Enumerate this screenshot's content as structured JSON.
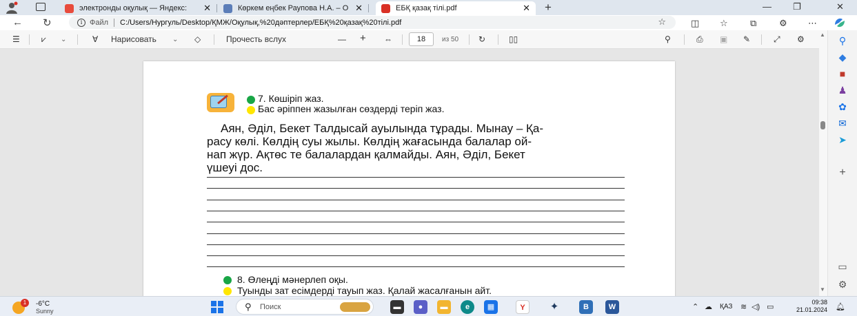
{
  "browser": {
    "tabs": [
      {
        "title": "электронды оқулық — Яндекс: ",
        "favicon_color": "#e84b3c",
        "active": false
      },
      {
        "title": "Көркем еңбек Раупова Н.А. – О",
        "favicon_color": "#5b7db8",
        "active": false
      },
      {
        "title": "ЕБҚ қазақ тілі.pdf",
        "favicon_color": "#d93025",
        "active": true
      }
    ],
    "new_tab_glyph": "+",
    "address": {
      "scheme_label": "Файл",
      "url": "C:/Users/Нургуль/Desktop/ҚМЖ/Оқулық,%20дәптерлер/ЕБҚ%20қазақ%20тілі.pdf"
    }
  },
  "pdf_toolbar": {
    "draw_label": "Нарисовать",
    "read_aloud_label": "Прочесть вслух",
    "page_number": "18",
    "page_total": "из 50"
  },
  "page": {
    "task7": {
      "line1": "7. Көшіріп жаз.",
      "line2": "Бас әріппен жазылған сөздерді теріп жаз."
    },
    "paragraph": [
      "Аян, Әділ, Бекет Талдысай ауылында тұрады. Мынау – Қа-",
      "расу көлі. Көлдің суы жылы. Көлдің жағасында балалар ой-",
      "нап жүр. Ақтөс те балалардан қалмайды. Аян, Әділ, Бекет",
      "үшеуі дос."
    ],
    "writing_lines": 9,
    "task8": {
      "line1": "8. Өлеңді мәнерлеп оқы.",
      "line2": "Туынды зат есімдерді тауып жаз. Қалай жасалғанын айт."
    },
    "colors": {
      "green_dot": "#19a646",
      "yellow_dot": "#ffe600"
    }
  },
  "taskbar": {
    "weather": {
      "temp": "-6°C",
      "condition": "Sunny",
      "badge": "1"
    },
    "search_placeholder": "Поиск",
    "apps": [
      {
        "name": "yandex-browser",
        "letter": "Y",
        "color": "#ffffff"
      },
      {
        "name": "dropbox",
        "letter": "✦",
        "color": "#1f3a5f"
      },
      {
        "name": "vk",
        "letter": "В",
        "color": "#2f6fb7"
      },
      {
        "name": "word",
        "letter": "W",
        "color": "#2b579a"
      }
    ],
    "language": "ҚАЗ",
    "time": "09:38",
    "date": "21.01.2024"
  }
}
